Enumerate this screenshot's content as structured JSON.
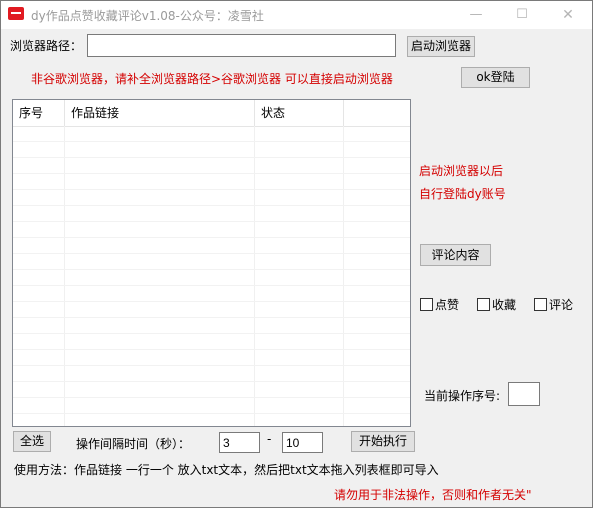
{
  "window": {
    "title": "dy作品点赞收藏评论v1.08-公众号：凌雪社",
    "min_glyph": "—",
    "max_glyph": "☐",
    "close_glyph": "✕"
  },
  "browser_path": {
    "label": "浏览器路径：",
    "value": "",
    "launch_button": "启动浏览器"
  },
  "notice_top": "非谷歌浏览器，请补全浏览器路径>谷歌浏览器 可以直接启动浏览器",
  "ok_login_button": "ok登陆",
  "table": {
    "columns": [
      "序号",
      "作品链接",
      "状态"
    ],
    "rows": []
  },
  "hint": {
    "line1": "启动浏览器以后",
    "line2": "自行登陆dy账号"
  },
  "comment_button": "评论内容",
  "options": {
    "like": "点赞",
    "favorite": "收藏",
    "comment": "评论"
  },
  "current_index": {
    "label": "当前操作序号:",
    "value": ""
  },
  "controls": {
    "select_all": "全选",
    "interval_label": "操作间隔时间（秒）：",
    "interval_min": "3",
    "dash": "-",
    "interval_max": "10",
    "start_button": "开始执行"
  },
  "usage": "使用方法：作品链接 一行一个 放入txt文本，然后把txt文本拖入列表框即可导入",
  "warning": "请勿用于非法操作，否则和作者无关\"",
  "colors": {
    "red_text": "#d40000",
    "app_icon": "#e11b22"
  }
}
